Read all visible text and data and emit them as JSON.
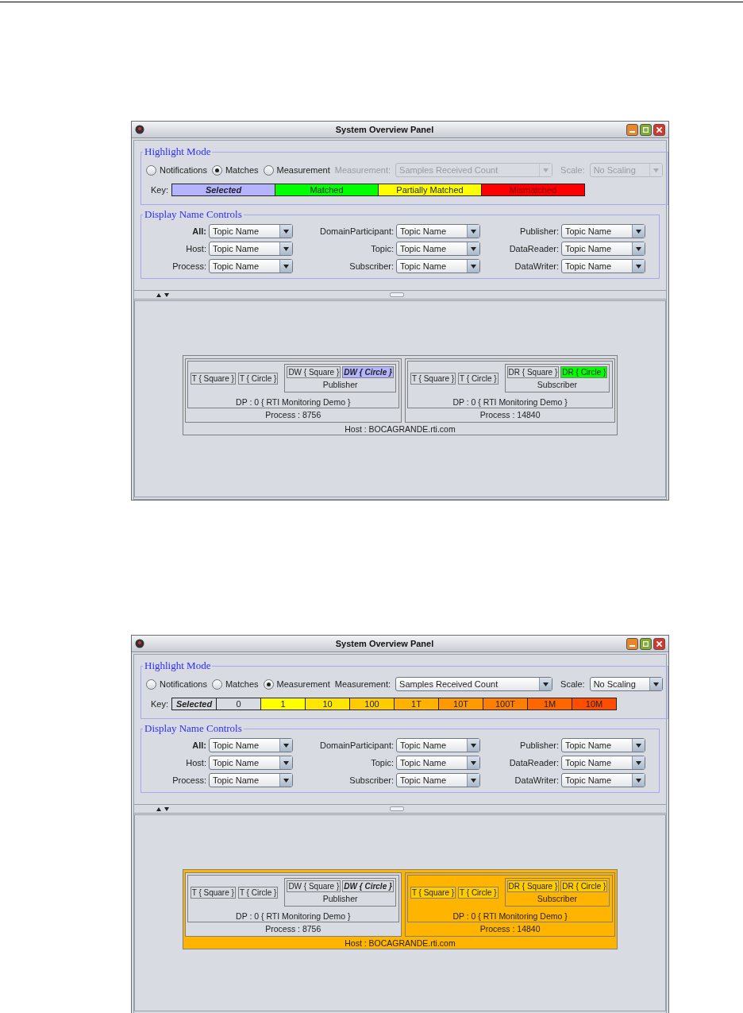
{
  "windows": [
    {
      "title": "System Overview Panel",
      "highlight_mode": {
        "title": "Highlight Mode",
        "radios": [
          {
            "label": "Notifications",
            "selected": false
          },
          {
            "label": "Matches",
            "selected": true
          },
          {
            "label": "Measurement",
            "selected": false
          }
        ],
        "measurement": {
          "label": "Measurement:",
          "value": "Samples Received Count",
          "disabled": true
        },
        "scale": {
          "label": "Scale:",
          "value": "No Scaling",
          "disabled": true
        },
        "key": {
          "label": "Key:",
          "entries": [
            {
              "kind": "selected",
              "label": "Selected",
              "color": "#b4b4ff"
            },
            {
              "kind": "value",
              "label": "Matched",
              "color": "#00ff00"
            },
            {
              "kind": "value",
              "label": "Partially Matched",
              "color": "#ffff00"
            },
            {
              "kind": "value",
              "label": "Mismatched",
              "color": "#ff0000"
            }
          ]
        }
      },
      "display_name_controls": {
        "title": "Display Name Controls",
        "controls": [
          {
            "label": "All:",
            "value": "Topic Name"
          },
          {
            "label": "DomainParticipant:",
            "value": "Topic Name"
          },
          {
            "label": "Publisher:",
            "value": "Topic Name"
          },
          {
            "label": "Host:",
            "value": "Topic Name"
          },
          {
            "label": "Topic:",
            "value": "Topic Name"
          },
          {
            "label": "DataReader:",
            "value": "Topic Name"
          },
          {
            "label": "Process:",
            "value": "Topic Name"
          },
          {
            "label": "Subscriber:",
            "value": "Topic Name"
          },
          {
            "label": "DataWriter:",
            "value": "Topic Name"
          }
        ]
      },
      "host": {
        "label": "Host : BOCAGRANDE.rti.com",
        "color": "#d8dbe2",
        "processes": [
          {
            "label": "Process : 8756",
            "color": "#d8dbe2",
            "participant": {
              "label": "DP : 0 { RTI Monitoring Demo }",
              "color": "#d8dbe2",
              "topics": [
                {
                  "label": "T { Square }",
                  "color": "#d8dbe2"
                },
                {
                  "label": "T { Circle }",
                  "color": "#d8dbe2"
                }
              ],
              "entity": {
                "label": "Publisher",
                "color": "#d8dbe2",
                "endpoints": [
                  {
                    "label": "DW { Square }",
                    "color": "#d8dbe2",
                    "selected": false
                  },
                  {
                    "label": "DW { Circle }",
                    "color": "#b4b4ff",
                    "selected": true
                  }
                ]
              }
            }
          },
          {
            "label": "Process : 14840",
            "color": "#d8dbe2",
            "participant": {
              "label": "DP : 0 { RTI Monitoring Demo }",
              "color": "#d8dbe2",
              "topics": [
                {
                  "label": "T { Square }",
                  "color": "#d8dbe2"
                },
                {
                  "label": "T { Circle }",
                  "color": "#d8dbe2"
                }
              ],
              "entity": {
                "label": "Subscriber",
                "color": "#d8dbe2",
                "endpoints": [
                  {
                    "label": "DR { Square }",
                    "color": "#d8dbe2",
                    "selected": false
                  },
                  {
                    "label": "DR { Circle }",
                    "color": "#00ff00",
                    "selected": false
                  }
                ]
              }
            }
          }
        ]
      }
    },
    {
      "title": "System Overview Panel",
      "highlight_mode": {
        "title": "Highlight Mode",
        "radios": [
          {
            "label": "Notifications",
            "selected": false
          },
          {
            "label": "Matches",
            "selected": false
          },
          {
            "label": "Measurement",
            "selected": true
          }
        ],
        "measurement": {
          "label": "Measurement:",
          "value": "Samples Received Count",
          "disabled": false
        },
        "scale": {
          "label": "Scale:",
          "value": "No Scaling",
          "disabled": false
        },
        "key": {
          "label": "Key:",
          "entries": [
            {
              "kind": "selected",
              "label": "Selected",
              "color": "#d8dbe2"
            },
            {
              "kind": "value",
              "label": "0",
              "color": "#d8dbe2"
            },
            {
              "kind": "value",
              "label": "1",
              "color": "#ffff00"
            },
            {
              "kind": "value",
              "label": "10",
              "color": "#ffe600"
            },
            {
              "kind": "value",
              "label": "100",
              "color": "#ffcc00"
            },
            {
              "kind": "value",
              "label": "1T",
              "color": "#ffb300"
            },
            {
              "kind": "value",
              "label": "10T",
              "color": "#ff9900"
            },
            {
              "kind": "value",
              "label": "100T",
              "color": "#ff8000"
            },
            {
              "kind": "value",
              "label": "1M",
              "color": "#ff6600"
            },
            {
              "kind": "value",
              "label": "10M",
              "color": "#ff4d00"
            }
          ]
        }
      },
      "display_name_controls": {
        "title": "Display Name Controls",
        "controls": [
          {
            "label": "All:",
            "value": "Topic Name"
          },
          {
            "label": "DomainParticipant:",
            "value": "Topic Name"
          },
          {
            "label": "Publisher:",
            "value": "Topic Name"
          },
          {
            "label": "Host:",
            "value": "Topic Name"
          },
          {
            "label": "Topic:",
            "value": "Topic Name"
          },
          {
            "label": "DataReader:",
            "value": "Topic Name"
          },
          {
            "label": "Process:",
            "value": "Topic Name"
          },
          {
            "label": "Subscriber:",
            "value": "Topic Name"
          },
          {
            "label": "DataWriter:",
            "value": "Topic Name"
          }
        ]
      },
      "host": {
        "label": "Host : BOCAGRANDE.rti.com",
        "color": "#ffb400",
        "processes": [
          {
            "label": "Process : 8756",
            "color": "#d8dbe2",
            "participant": {
              "label": "DP : 0 { RTI Monitoring Demo }",
              "color": "#d8dbe2",
              "topics": [
                {
                  "label": "T { Square }",
                  "color": "#d8dbe2"
                },
                {
                  "label": "T { Circle }",
                  "color": "#d8dbe2"
                }
              ],
              "entity": {
                "label": "Publisher",
                "color": "#d8dbe2",
                "endpoints": [
                  {
                    "label": "DW { Square }",
                    "color": "#d8dbe2",
                    "selected": false
                  },
                  {
                    "label": "DW { Circle }",
                    "color": "#d8dbe2",
                    "selected": true
                  }
                ]
              }
            }
          },
          {
            "label": "Process : 14840",
            "color": "#ffb400",
            "participant": {
              "label": "DP : 0 { RTI Monitoring Demo }",
              "color": "#ffb400",
              "topics": [
                {
                  "label": "T { Square }",
                  "color": "#ffcc00"
                },
                {
                  "label": "T { Circle }",
                  "color": "#ffcc00"
                }
              ],
              "entity": {
                "label": "Subscriber",
                "color": "#ffb400",
                "endpoints": [
                  {
                    "label": "DR { Square }",
                    "color": "#ffcc00",
                    "selected": false
                  },
                  {
                    "label": "DR { Circle }",
                    "color": "#ffcc00",
                    "selected": false
                  }
                ]
              }
            }
          }
        ]
      }
    }
  ]
}
